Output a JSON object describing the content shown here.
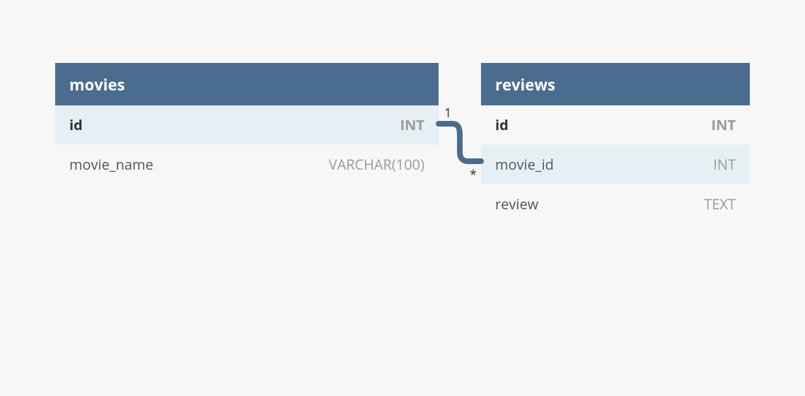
{
  "tables": {
    "movies": {
      "name": "movies",
      "columns": [
        {
          "name": "id",
          "type": "INT",
          "pk": true
        },
        {
          "name": "movie_name",
          "type": "VARCHAR(100)",
          "pk": false
        }
      ]
    },
    "reviews": {
      "name": "reviews",
      "columns": [
        {
          "name": "id",
          "type": "INT",
          "pk": true
        },
        {
          "name": "movie_id",
          "type": "INT",
          "pk": false
        },
        {
          "name": "review",
          "type": "TEXT",
          "pk": false
        }
      ]
    }
  },
  "relationship": {
    "from_cardinality": "1",
    "to_cardinality": "*"
  },
  "colors": {
    "header_bg": "#4a6c8f",
    "highlight_bg": "#e6eff4",
    "page_bg": "#f7f7f7",
    "text_dark": "#333333",
    "text_mid": "#555555",
    "text_light": "#9a9a9a",
    "connector": "#4a6c8f"
  }
}
